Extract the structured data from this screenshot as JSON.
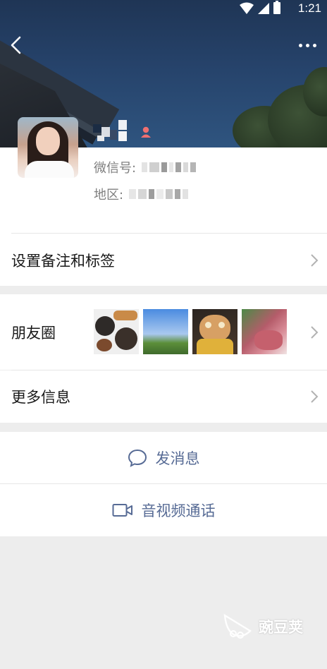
{
  "status_bar": {
    "time": "1:21"
  },
  "profile": {
    "wechat_id_label": "微信号:",
    "region_label": "地区:"
  },
  "menu": {
    "remark_tags": "设置备注和标签",
    "moments": "朋友圈",
    "more_info": "更多信息"
  },
  "actions": {
    "send_message": "发消息",
    "video_call": "音视频通话"
  },
  "colors": {
    "action_blue": "#576b95",
    "gender_female": "#f07070",
    "page_bg": "#ededed"
  },
  "watermark": {
    "text": "豌豆荚"
  }
}
